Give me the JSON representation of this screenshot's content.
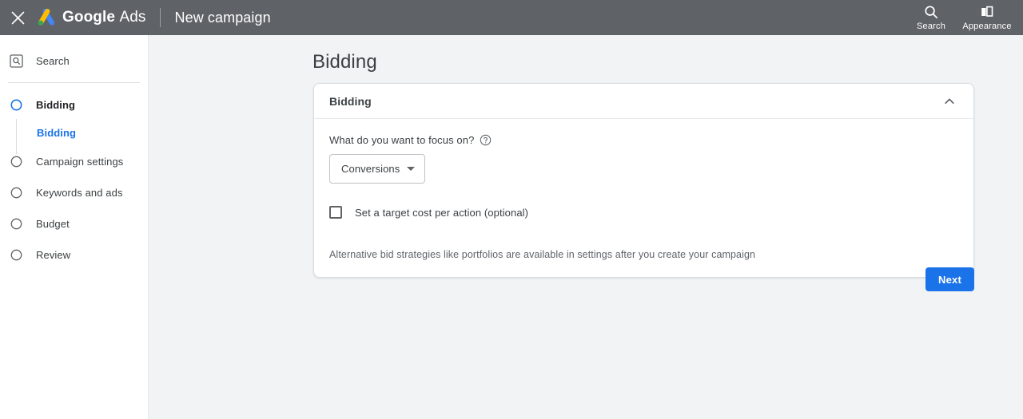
{
  "topbar": {
    "close_icon": "close-icon",
    "logo_icon": "google-ads-logo",
    "brand_strong": "Google",
    "brand_light": "Ads",
    "page_context": "New campaign",
    "actions": [
      {
        "icon": "search-icon",
        "label": "Search"
      },
      {
        "icon": "appearance-icon",
        "label": "Appearance"
      }
    ],
    "background_color": "#5f6368"
  },
  "sidebar": {
    "campaign_type": {
      "icon": "search-campaign-icon",
      "label": "Search"
    },
    "steps": [
      {
        "label": "Bidding",
        "icon": "radio-active-icon",
        "active": true,
        "state": "current"
      },
      {
        "label": "Campaign settings",
        "icon": "radio-icon",
        "active": false,
        "state": "pending"
      },
      {
        "label": "Keywords and ads",
        "icon": "radio-icon",
        "active": false,
        "state": "pending"
      },
      {
        "label": "Budget",
        "icon": "radio-icon",
        "active": false,
        "state": "pending"
      },
      {
        "label": "Review",
        "icon": "radio-icon",
        "active": false,
        "state": "pending"
      }
    ],
    "sub_items": [
      {
        "label": "Bidding",
        "active": true
      }
    ],
    "active_color": "#1a73e8"
  },
  "main": {
    "page_title": "Bidding",
    "card": {
      "header_title": "Bidding",
      "collapse_icon": "chevron-up-icon",
      "expanded": true,
      "field_label": "What do you want to focus on?",
      "help_icon": "help-circle-icon",
      "select": {
        "value": "Conversions",
        "caret_icon": "caret-down-icon",
        "options": [
          "Conversions"
        ]
      },
      "checkbox": {
        "label": "Set a target cost per action (optional)",
        "checked": false
      },
      "note": "Alternative bid strategies like portfolios are available in settings after you create your campaign"
    },
    "next_button": "Next",
    "accent_color": "#1a73e8",
    "background_color": "#f1f3f4"
  }
}
